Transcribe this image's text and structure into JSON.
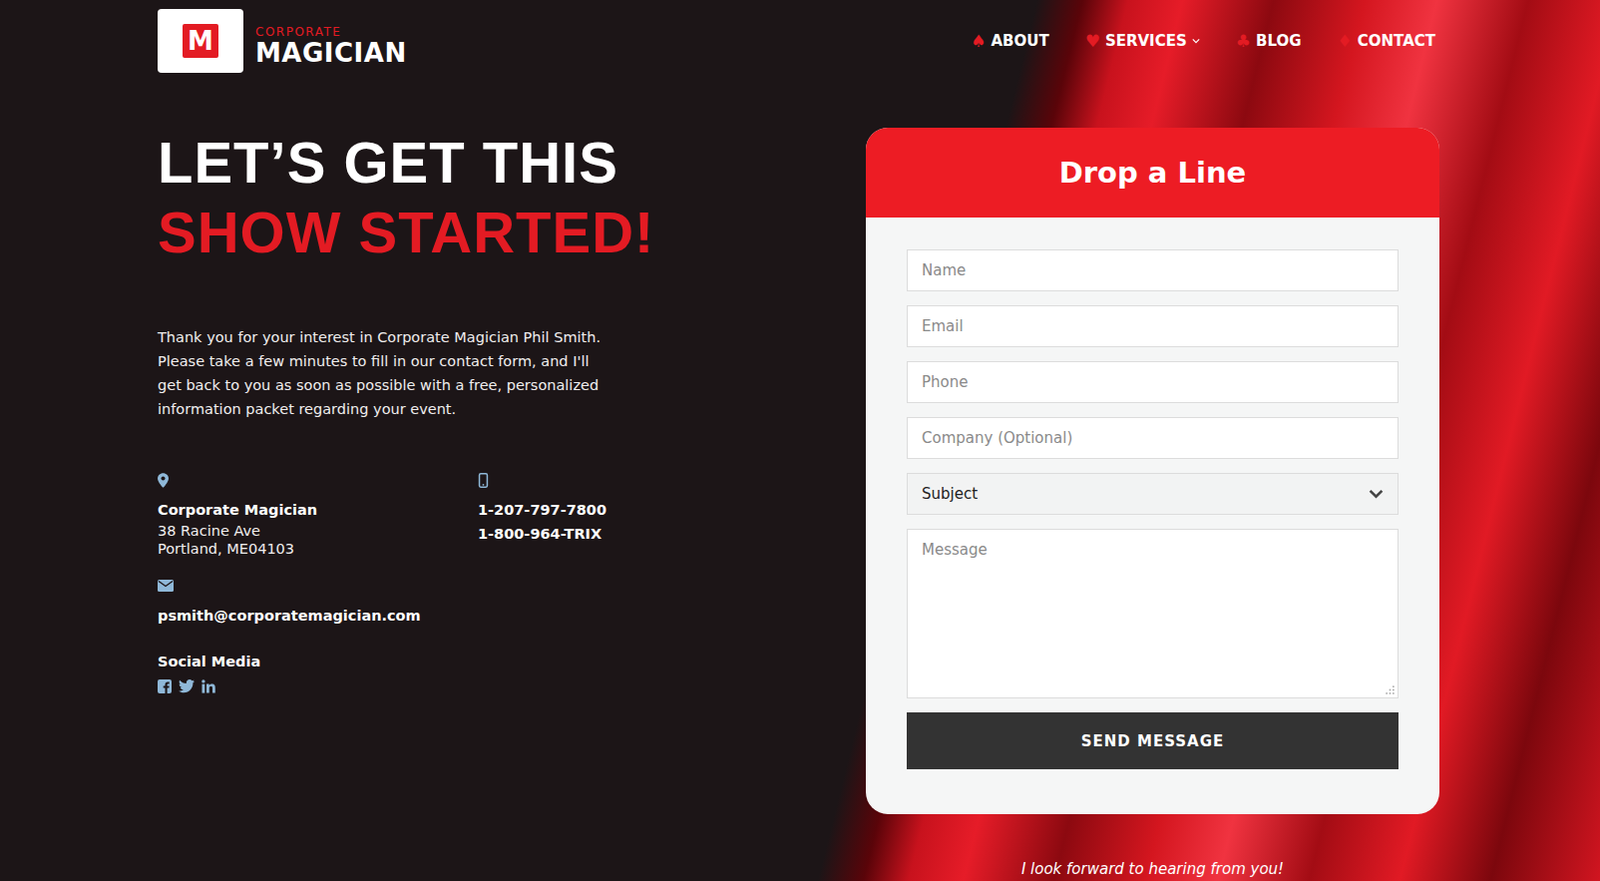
{
  "logo": {
    "letter": "M",
    "top": "CORPORATE",
    "bottom": "MAGICIAN"
  },
  "nav": [
    {
      "label": "ABOUT",
      "icon": "♠",
      "has_menu": false
    },
    {
      "label": "SERVICES",
      "icon": "♥",
      "has_menu": true
    },
    {
      "label": "BLOG",
      "icon": "♣",
      "has_menu": false
    },
    {
      "label": "CONTACT",
      "icon": "♦",
      "has_menu": false
    }
  ],
  "heading": {
    "line1": "LET’S GET THIS",
    "line2": "SHOW STARTED!"
  },
  "intro": "Thank you for your interest in Corporate Magician Phil Smith. Please take a few minutes to fill in our contact form, and I'll get back to you as soon as possible with a free, personalized information packet regarding your event.",
  "address": {
    "name": "Corporate Magician",
    "lines": [
      "38 Racine Ave",
      "Portland, ME04103"
    ]
  },
  "phones": [
    "1-207-797-7800",
    "1-800-964-TRIX"
  ],
  "email": "psmith@corporatemagician.com",
  "social": {
    "label": "Social Media"
  },
  "form": {
    "title": "Drop a Line",
    "fields": [
      "Name",
      "Email",
      "Phone",
      "Company  (Optional)"
    ],
    "subject": "Subject",
    "message": "Message",
    "button": "SEND MESSAGE"
  },
  "footer": "I look forward to hearing from you!"
}
